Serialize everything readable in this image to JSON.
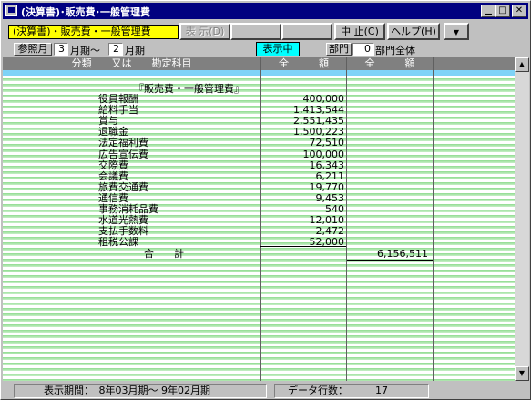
{
  "window": {
    "title": "(決算書)･販売費･一般管理費",
    "minimize_icon": "minimize-icon",
    "maximize_icon": "maximize-icon",
    "close_icon": "close-icon"
  },
  "toolbar": {
    "report_label": "(決算書)・販売費・一般管理費",
    "display_button": "表 示(D)",
    "stop_button": "中 止(C)",
    "help_button": "ヘルプ(H)"
  },
  "filters": {
    "ref_month_label": "参照月",
    "ref_from": "3",
    "month_from_label": "月期～",
    "ref_to": "2",
    "month_to_label": "月期",
    "showing_badge": "表示中",
    "dept_label": "部門",
    "dept_value": "0",
    "dept_name": "部門全体"
  },
  "table": {
    "headers": [
      "分類　　又は　　勘定科目",
      "全　　　額",
      "全　　　額"
    ],
    "section_title": "『販売費・一般管理費』",
    "rows": [
      {
        "name": "役員報酬",
        "amount": "400,000"
      },
      {
        "name": "給料手当",
        "amount": "1,413,544"
      },
      {
        "name": "賞与",
        "amount": "2,551,435"
      },
      {
        "name": "退職金",
        "amount": "1,500,223"
      },
      {
        "name": "法定福利費",
        "amount": "72,510"
      },
      {
        "name": "広告宣伝費",
        "amount": "100,000"
      },
      {
        "name": "交際費",
        "amount": "16,343"
      },
      {
        "name": "会議費",
        "amount": "6,211"
      },
      {
        "name": "旅費交通費",
        "amount": "19,770"
      },
      {
        "name": "通信費",
        "amount": "9,453"
      },
      {
        "name": "事務消耗品費",
        "amount": "540"
      },
      {
        "name": "水道光熱費",
        "amount": "12,010"
      },
      {
        "name": "支払手数料",
        "amount": "2,472"
      },
      {
        "name": "租税公課",
        "amount": "52,000"
      }
    ],
    "total_label": "合　　計",
    "total_amount": "6,156,511"
  },
  "status": {
    "period": "表示期間：　8年03月期～ 9年02月期",
    "row_count_label": "データ行数：",
    "row_count": "17"
  }
}
